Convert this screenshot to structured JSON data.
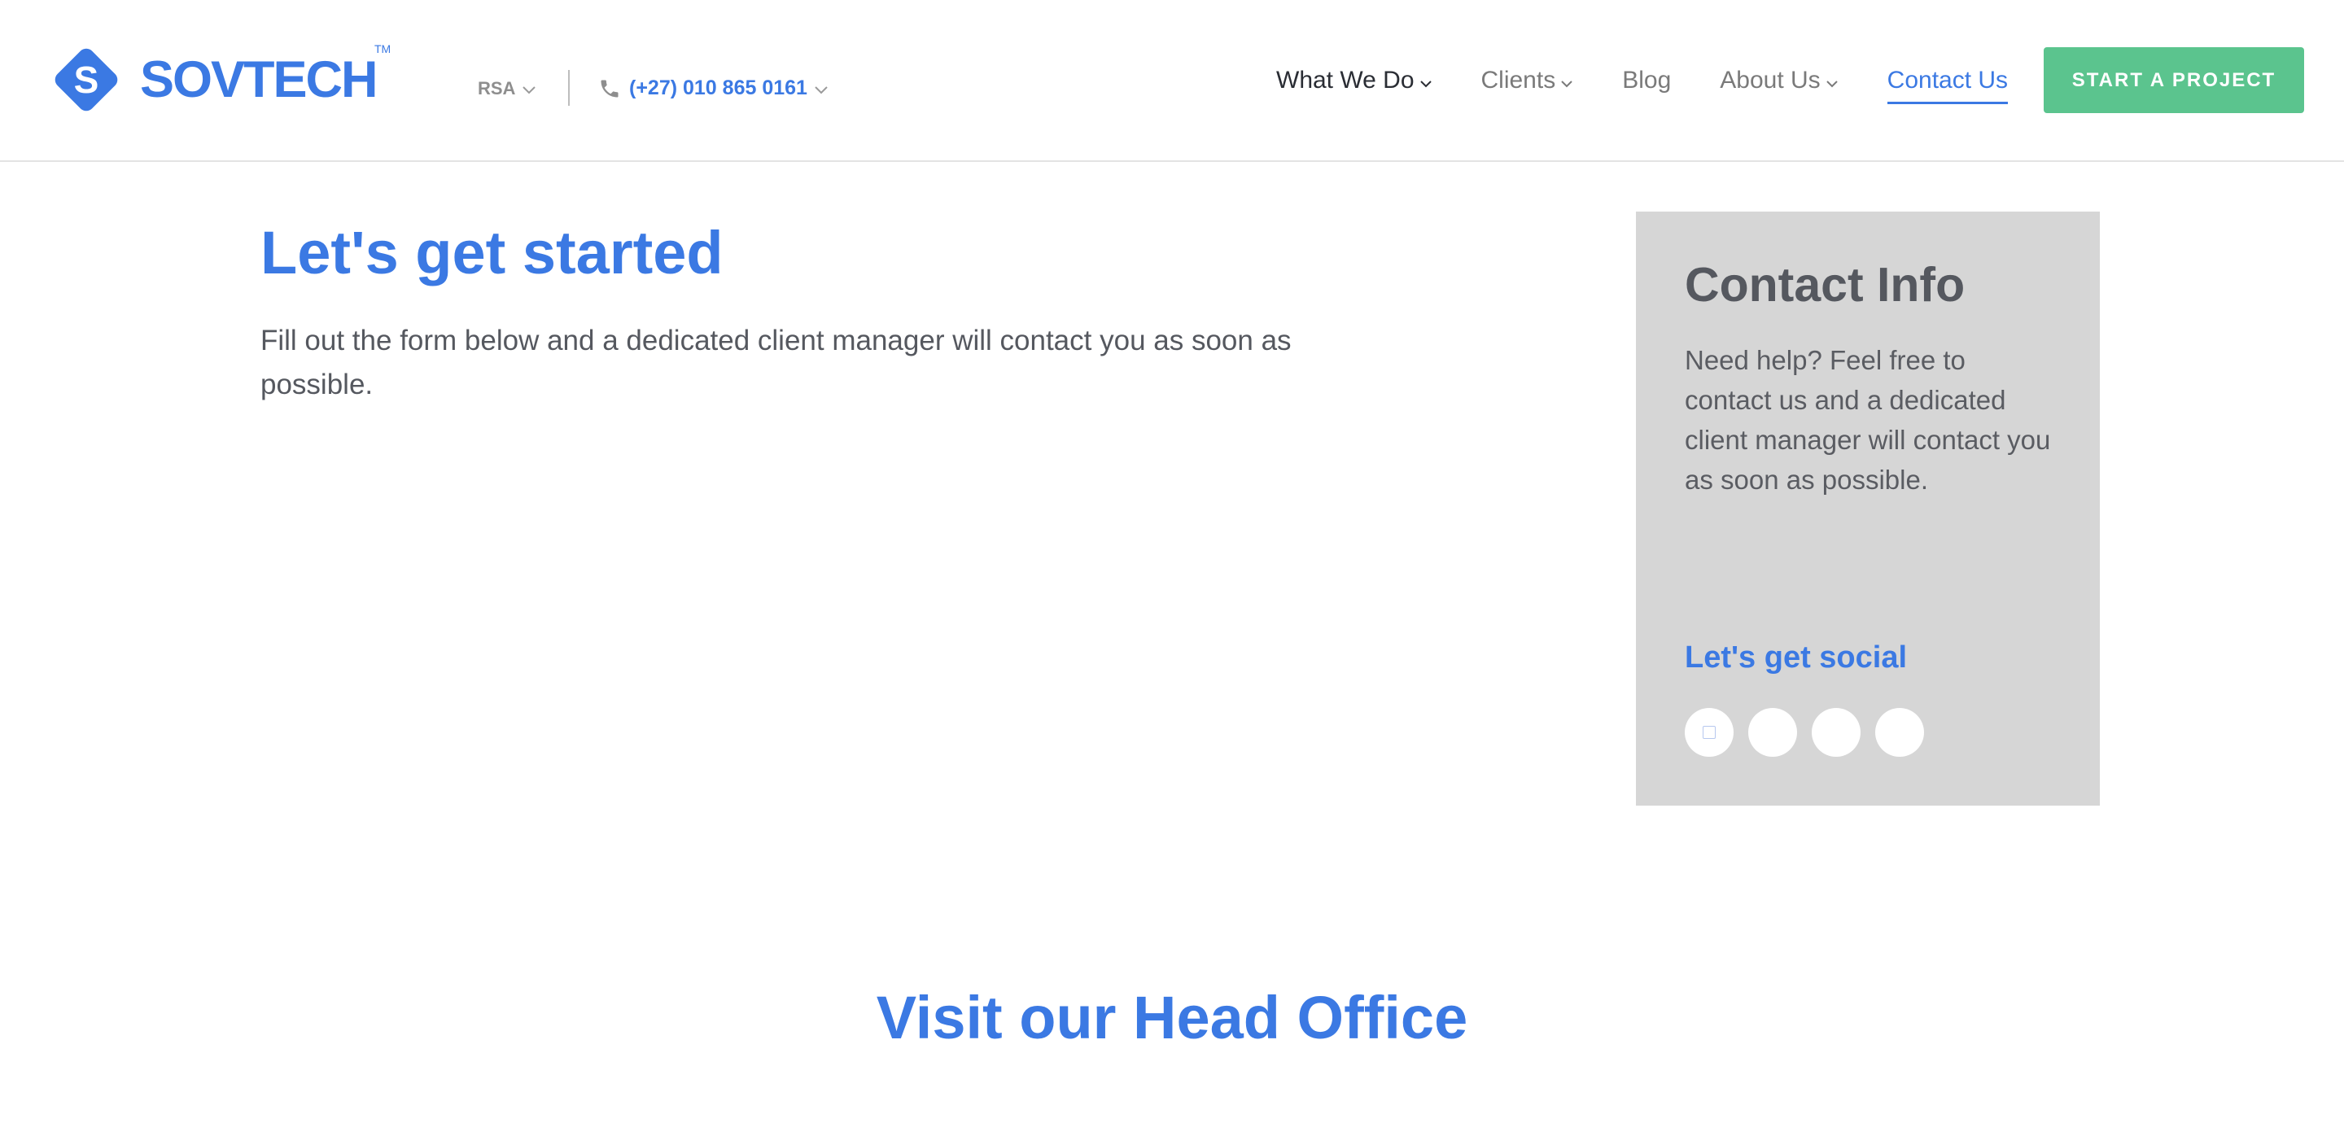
{
  "header": {
    "brand": "SOVTECH",
    "trademark": "TM",
    "region": "RSA",
    "phone": "(+27) 010 865 0161",
    "nav": [
      {
        "label": "What We Do"
      },
      {
        "label": "Clients"
      },
      {
        "label": "Blog"
      },
      {
        "label": "About Us"
      },
      {
        "label": "Contact Us"
      }
    ],
    "cta": "START A PROJECT"
  },
  "hero": {
    "title": "Let's get started",
    "subtitle": "Fill out the form below and a dedicated client manager will contact you as soon as possible."
  },
  "contact_info": {
    "title": "Contact Info",
    "text": "Need help? Feel free to contact us and a dedicated client manager will contact you as soon as possible.",
    "social_title": "Let's get social"
  },
  "office": {
    "title": "Visit our Head Office"
  },
  "colors": {
    "brand_blue": "#3b79e3",
    "cta_green": "#5bc48e",
    "card_gray": "#d6d6d6"
  }
}
